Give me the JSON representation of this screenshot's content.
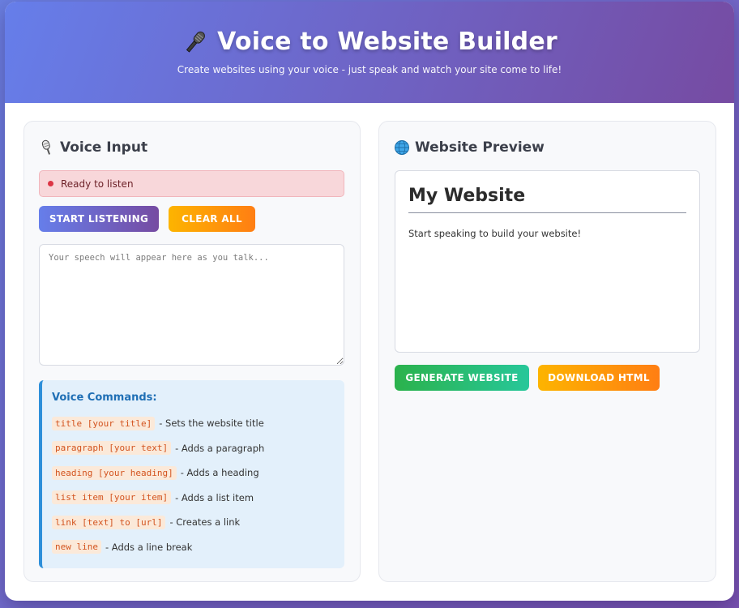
{
  "header": {
    "title": "Voice to Website Builder",
    "title_icon": "microphone-icon",
    "subtitle": "Create websites using your voice - just speak and watch your site come to life!"
  },
  "voice_panel": {
    "heading": "Voice Input",
    "heading_icon": "microphone-stand-icon",
    "status_text": "Ready to listen",
    "status_color": "#dc3545",
    "start_label": "START LISTENING",
    "clear_label": "CLEAR ALL",
    "speech_placeholder": "Your speech will appear here as you talk...",
    "speech_value": "",
    "commands_title": "Voice Commands:",
    "commands": [
      {
        "code": "title [your title]",
        "desc": "- Sets the website title"
      },
      {
        "code": "paragraph [your text]",
        "desc": "- Adds a paragraph"
      },
      {
        "code": "heading [your heading]",
        "desc": "- Adds a heading"
      },
      {
        "code": "list item [your item]",
        "desc": "- Adds a list item"
      },
      {
        "code": "link [text] to [url]",
        "desc": "- Creates a link"
      },
      {
        "code": "new line",
        "desc": "- Adds a line break"
      }
    ]
  },
  "preview_panel": {
    "heading": "Website Preview",
    "heading_icon": "globe-icon",
    "site_title": "My Website",
    "site_text": "Start speaking to build your website!",
    "generate_label": "GENERATE WEBSITE",
    "download_label": "DOWNLOAD HTML"
  },
  "colors": {
    "accent_start": "#667eea",
    "accent_end": "#764ba2",
    "orange": "#ff7e13",
    "green": "#2bb24c",
    "command_code": "#d3541f"
  }
}
